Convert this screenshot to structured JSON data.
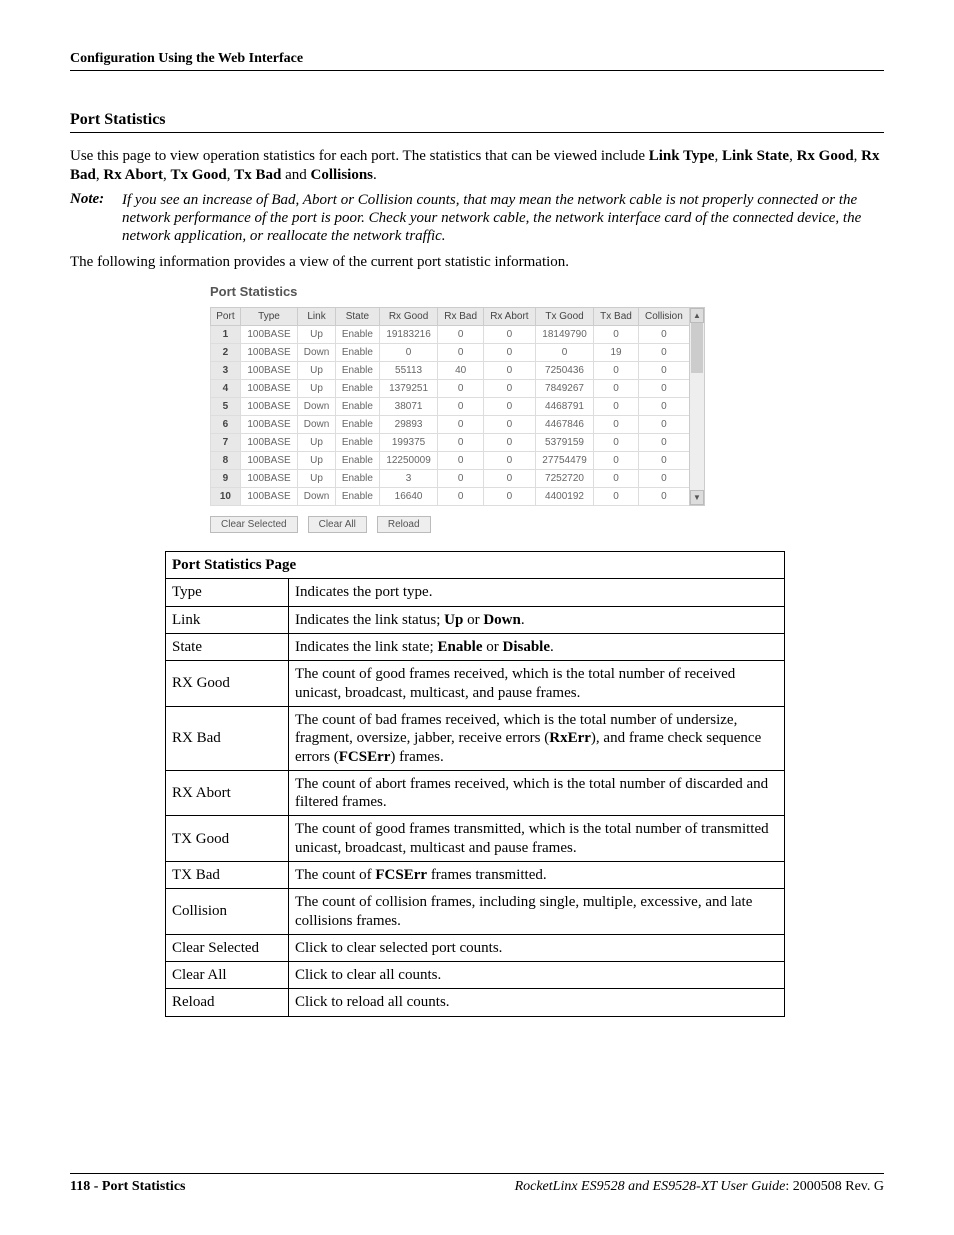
{
  "header": {
    "title": "Configuration Using the Web Interface"
  },
  "section": {
    "title": "Port Statistics",
    "intro_pre": "Use this page to view operation statistics for each port. The statistics that can be viewed include ",
    "intro_terms": [
      "Link Type",
      "Link State",
      "Rx Good",
      "Rx Bad",
      "Rx Abort",
      "Tx Good",
      "Tx Bad",
      "Collisions"
    ],
    "intro_and": " and ",
    "note_label": "Note:",
    "note_body": "If you see an increase of Bad, Abort or Collision counts, that may mean the network cable is not properly connected or the network performance of the port is poor. Check your network cable, the network interface card of the connected device, the network application, or reallocate the network traffic.",
    "lead_in": "The following information provides a view of the current port statistic information."
  },
  "screenshot": {
    "title": "Port Statistics",
    "headers": [
      "Port",
      "Type",
      "Link",
      "State",
      "Rx Good",
      "Rx Bad",
      "Rx Abort",
      "Tx Good",
      "Tx Bad",
      "Collision"
    ],
    "rows": [
      [
        "1",
        "100BASE",
        "Up",
        "Enable",
        "19183216",
        "0",
        "0",
        "18149790",
        "0",
        "0"
      ],
      [
        "2",
        "100BASE",
        "Down",
        "Enable",
        "0",
        "0",
        "0",
        "0",
        "19",
        "0"
      ],
      [
        "3",
        "100BASE",
        "Up",
        "Enable",
        "55113",
        "40",
        "0",
        "7250436",
        "0",
        "0"
      ],
      [
        "4",
        "100BASE",
        "Up",
        "Enable",
        "1379251",
        "0",
        "0",
        "7849267",
        "0",
        "0"
      ],
      [
        "5",
        "100BASE",
        "Down",
        "Enable",
        "38071",
        "0",
        "0",
        "4468791",
        "0",
        "0"
      ],
      [
        "6",
        "100BASE",
        "Down",
        "Enable",
        "29893",
        "0",
        "0",
        "4467846",
        "0",
        "0"
      ],
      [
        "7",
        "100BASE",
        "Up",
        "Enable",
        "199375",
        "0",
        "0",
        "5379159",
        "0",
        "0"
      ],
      [
        "8",
        "100BASE",
        "Up",
        "Enable",
        "12250009",
        "0",
        "0",
        "27754479",
        "0",
        "0"
      ],
      [
        "9",
        "100BASE",
        "Up",
        "Enable",
        "3",
        "0",
        "0",
        "7252720",
        "0",
        "0"
      ],
      [
        "10",
        "100BASE",
        "Down",
        "Enable",
        "16640",
        "0",
        "0",
        "4400192",
        "0",
        "0"
      ]
    ],
    "buttons": {
      "clear_selected": "Clear Selected",
      "clear_all": "Clear All",
      "reload": "Reload"
    }
  },
  "desc": {
    "caption": "Port Statistics Page",
    "rows": [
      {
        "label": "Type",
        "text": "Indicates the port type."
      },
      {
        "label": "Link",
        "html": "Indicates the link status; <b>Up</b> or <b>Down</b>."
      },
      {
        "label": "State",
        "html": "Indicates the link state; <b>Enable</b> or <b>Disable</b>."
      },
      {
        "label": "RX Good",
        "text": "The count of good frames received, which is the total number of received unicast, broadcast, multicast, and pause frames."
      },
      {
        "label": "RX Bad",
        "html": "The count of bad frames received, which is the total number of undersize, fragment, oversize, jabber, receive errors (<b>RxErr</b>), and frame check sequence errors (<b>FCSErr</b>) frames."
      },
      {
        "label": "RX Abort",
        "text": "The count of abort frames received, which is the total number of discarded and filtered frames."
      },
      {
        "label": "TX Good",
        "text": "The count of good frames transmitted, which is the total number of transmitted unicast, broadcast, multicast and pause frames."
      },
      {
        "label": "TX Bad",
        "html": "The count of <b>FCSErr</b> frames transmitted."
      },
      {
        "label": "Collision",
        "text": "The count of collision frames, including single, multiple, excessive, and late collisions frames."
      },
      {
        "label": "Clear Selected",
        "text": "Click to clear selected port counts."
      },
      {
        "label": "Clear All",
        "text": "Click to clear all counts."
      },
      {
        "label": "Reload",
        "text": "Click to reload all counts."
      }
    ]
  },
  "footer": {
    "page": "118 - Port Statistics",
    "guide": "RocketLinx ES9528 and ES9528-XT User Guide",
    "rev": ": 2000508 Rev. G"
  }
}
